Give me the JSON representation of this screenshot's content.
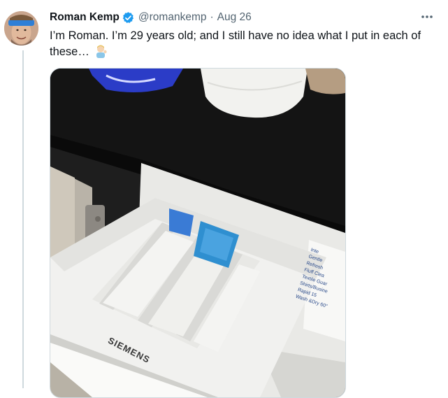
{
  "tweet": {
    "author_name": "Roman Kemp",
    "handle": "@romankemp",
    "separator": "·",
    "timestamp": "Aug 26",
    "text": "I’m Roman. I’m 29 years old; and I still have no idea what I put in each of these…",
    "emoji": "man-tipping-hand-emoji",
    "verified": true
  },
  "media": {
    "brand_text": "SIEMENS",
    "label_lines": [
      "Inte",
      "Gentle",
      "Refresh",
      "Fluff Clea",
      "Textile Guar",
      "Shirts/Busine",
      "Rapid 15",
      "Wash &Dry 60°"
    ]
  },
  "colors": {
    "verified_badge": "#1d9bf0",
    "secondary_text": "#536471",
    "thread_line": "#cfd9de"
  }
}
